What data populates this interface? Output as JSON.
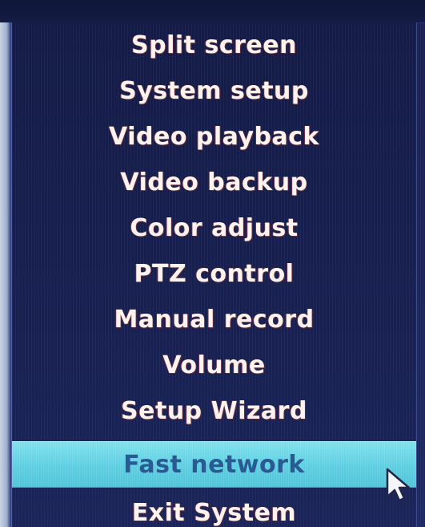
{
  "menu": {
    "selected_index": 9,
    "items": [
      {
        "label": "Split screen"
      },
      {
        "label": "System setup"
      },
      {
        "label": "Video playback"
      },
      {
        "label": "Video backup"
      },
      {
        "label": "Color adjust"
      },
      {
        "label": "PTZ control"
      },
      {
        "label": "Manual record"
      },
      {
        "label": "Volume"
      },
      {
        "label": "Setup Wizard"
      },
      {
        "label": "Fast network"
      },
      {
        "label": "Exit System"
      }
    ]
  },
  "colors": {
    "menu_background": "#1a2458",
    "text": "#fff3ee",
    "highlight": "#5fd0e2",
    "highlight_text": "#2a5a92"
  },
  "icons": {
    "pointer": "mouse-pointer-icon"
  }
}
